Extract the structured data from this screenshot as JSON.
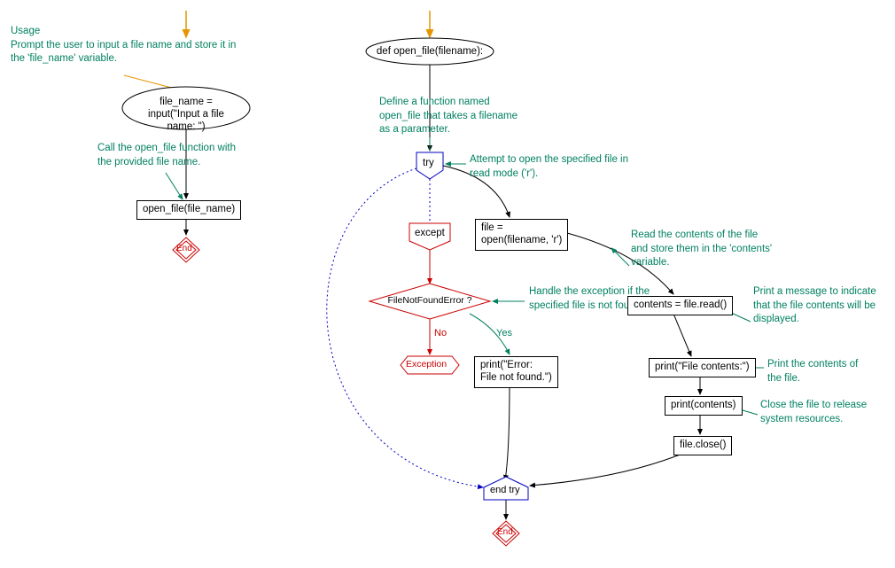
{
  "left": {
    "usage_heading": "Usage",
    "usage_text": "Prompt the user to input a file name and store it in the 'file_name' variable.",
    "input_box": "file_name = input(\"Input a file name: \")",
    "call_text": "Call the open_file function with the provided file name.",
    "call_box": "open_file(file_name)",
    "end_label": "End"
  },
  "right": {
    "def_box": "def open_file(filename):",
    "def_text": "Define a function named open_file that takes a filename as a parameter.",
    "try_label": "try",
    "try_text": "Attempt to open the specified file in read mode ('r').",
    "except_label": "except",
    "open_box_l1": "file =",
    "open_box_l2": "open(filename, 'r')",
    "read_text": "Read the contents of the file and store them in the 'contents' variable.",
    "contents_box": "contents = file.read()",
    "msg_text": "Print a message to indicate that the file contents will be displayed.",
    "err_question": "FileNotFoundError ?",
    "err_text": "Handle the exception if the specified file is not found.",
    "no_label": "No",
    "yes_label": "Yes",
    "exception_label": "Exception",
    "print_err_l1": "print(\"Error:",
    "print_err_l2": "File not found.\")",
    "print_msg_box": "print(\"File contents:\")",
    "print_text": "Print the contents of the file.",
    "print_contents_box": "print(contents)",
    "close_text": "Close the file to release system resources.",
    "close_box": "file.close()",
    "end_try_label": "end try",
    "end_label": "End"
  }
}
